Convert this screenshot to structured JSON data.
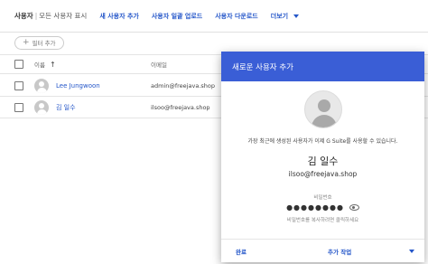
{
  "topbar": {
    "breadcrumb_main": "사용자",
    "breadcrumb_sep": "|",
    "breadcrumb_sub": "모든 사용자 표시",
    "actions": [
      "새 사용자 추가",
      "사용자 일괄 업로드",
      "사용자 다운로드"
    ],
    "more_label": "더보기"
  },
  "filter": {
    "plus": "+",
    "label": "필터 추가"
  },
  "table": {
    "col_name": "이름",
    "col_email": "이메일",
    "rows": [
      {
        "name": "Lee Jungwoon",
        "email": "admin@freejava.shop"
      },
      {
        "name": "김 일수",
        "email": "ilsoo@freejava.shop"
      }
    ]
  },
  "dialog": {
    "title": "새로운 사용자 추가",
    "message": "가장 최근에 생성된 사용자가 이제 G Suite를 사용할 수 있습니다.",
    "user_name": "김 일수",
    "user_email": "ilsoo@freejava.shop",
    "password_label": "비밀번호",
    "password_masked": "●●●●●●●●",
    "password_hint": "비밀번호를 복사하려면 클릭하세요",
    "done_label": "완료",
    "more_label": "추가 작업"
  },
  "colors": {
    "accent": "#3a5ed6",
    "link": "#2456c9"
  },
  "icons": [
    "sort-arrow-up-icon",
    "chevron-down-icon",
    "eye-icon",
    "avatar-icon"
  ]
}
